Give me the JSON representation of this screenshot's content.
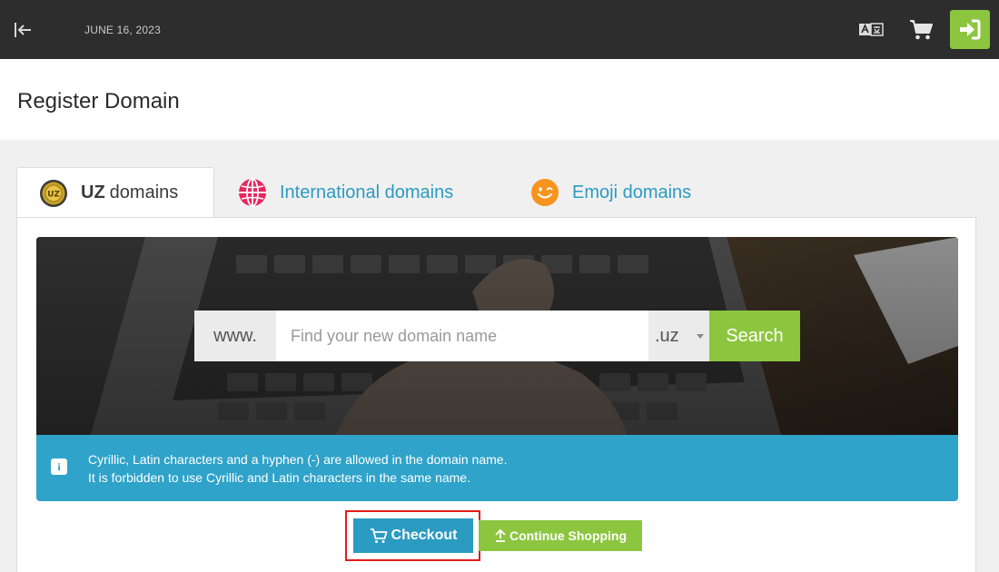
{
  "topbar": {
    "date": "JUNE 16, 2023",
    "icons": {
      "collapse": "arrow-left-to-line-icon",
      "language": "translate-icon",
      "cart": "shopping-cart-icon",
      "login": "sign-in-icon"
    },
    "accent_color": "#8cc63f"
  },
  "page": {
    "title": "Register Domain"
  },
  "tabs": [
    {
      "strong": "UZ",
      "label": "domains",
      "icon": "uz-badge-icon",
      "active": true
    },
    {
      "label": "International domains",
      "icon": "globe-icon",
      "active": false
    },
    {
      "label": "Emoji domains",
      "icon": "smiley-icon",
      "active": false
    }
  ],
  "search": {
    "prefix": "www.",
    "placeholder": "Find your new domain name",
    "value": "",
    "tld": ".uz",
    "button_label": "Search"
  },
  "info": {
    "line1": "Cyrillic, Latin characters and a hyphen (-) are allowed in the domain name.",
    "line2": "It is forbidden to use Cyrillic and Latin characters in the same name.",
    "icon": "info-icon",
    "color": "#2fa3c9"
  },
  "actions": {
    "checkout_label": "Checkout",
    "continue_label": "Continue Shopping",
    "checkout_color": "#2b9bc2",
    "continue_color": "#8cc63f",
    "highlight_color": "#e21b1b"
  }
}
